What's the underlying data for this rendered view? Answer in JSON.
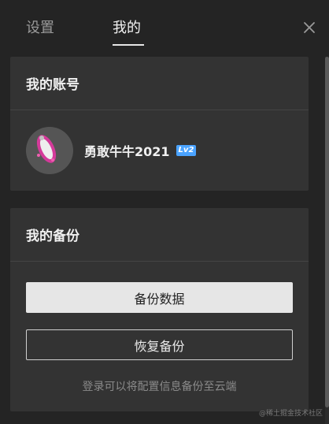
{
  "tabs": [
    {
      "label": "设置",
      "active": false
    },
    {
      "label": "我的",
      "active": true
    }
  ],
  "close_icon": "close-icon",
  "account_card": {
    "title": "我的账号",
    "username": "勇敢牛牛2021",
    "level_badge": "Lv2"
  },
  "backup_card": {
    "title": "我的备份",
    "backup_button": "备份数据",
    "restore_button": "恢复备份",
    "hint": "登录可以将配置信息备份至云端"
  },
  "watermark": "@稀土掘金技术社区",
  "colors": {
    "background": "#242424",
    "card": "#333333",
    "primary_button": "#e6e6e6",
    "badge": "#4aa3ff"
  }
}
